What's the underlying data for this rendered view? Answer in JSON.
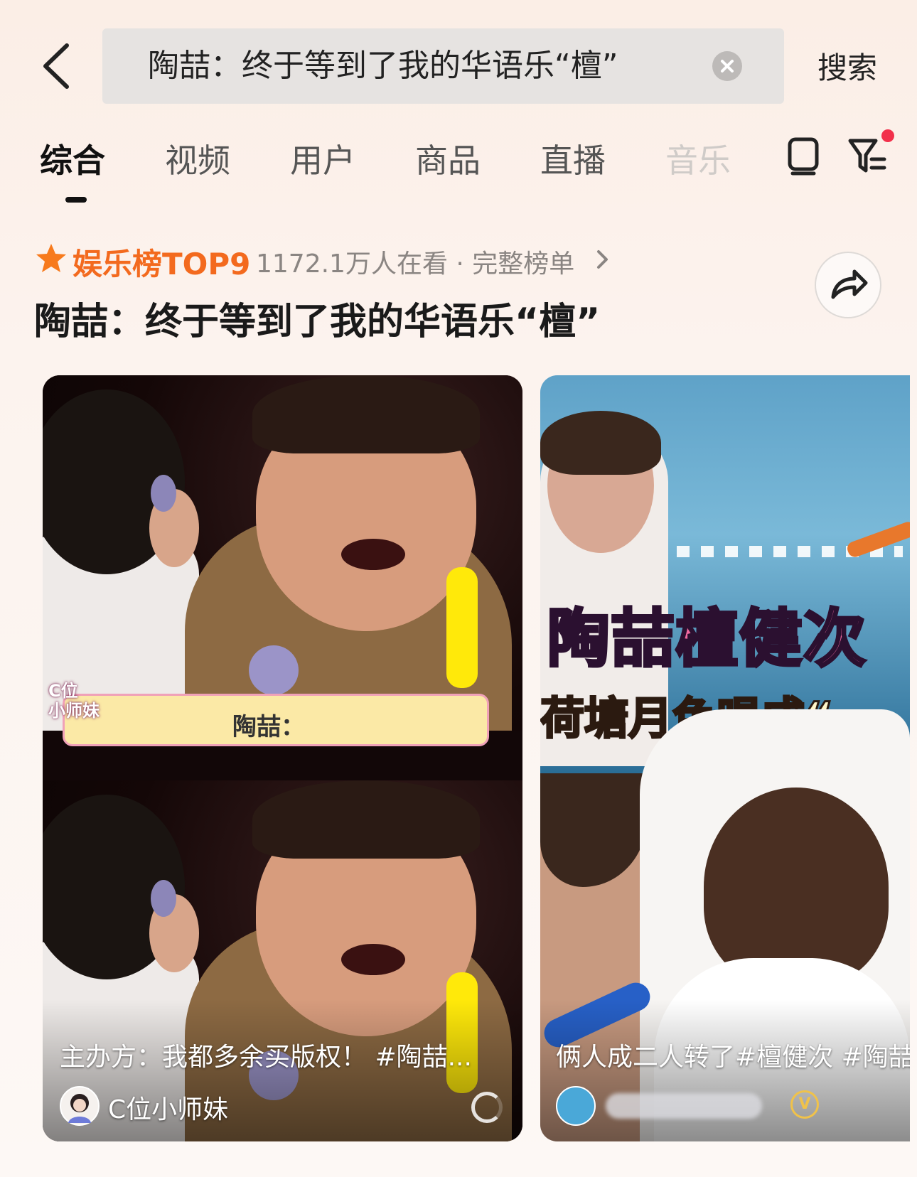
{
  "search": {
    "query": "陶喆：终于等到了我的华语乐“檀”",
    "submit_label": "搜索"
  },
  "tabs": [
    {
      "label": "综合",
      "active": true
    },
    {
      "label": "视频",
      "active": false
    },
    {
      "label": "用户",
      "active": false
    },
    {
      "label": "商品",
      "active": false
    },
    {
      "label": "直播",
      "active": false
    },
    {
      "label": "音乐",
      "active": false
    }
  ],
  "ranking": {
    "label": "娱乐榜TOP9",
    "meta": "1172.1万人在看 · 完整榜单",
    "accent_color": "#f36a1e"
  },
  "topic": {
    "title": "陶喆：终于等到了我的华语乐“檀”"
  },
  "cards": [
    {
      "badge": "C位\n小师妹",
      "caption": "陶喆：",
      "description": "主办方：我都多余买版权！ #陶喆...",
      "author": "C位小师妹"
    },
    {
      "overlay_title": "陶喆檀健次",
      "overlay_subtitle": "荷塘月色唱成“",
      "description": "俩人成二人转了#檀健次 #陶喆",
      "verified_badge": "V"
    }
  ],
  "icons": {
    "back": "chevron-left-icon",
    "clear": "clear-circle-icon",
    "filter": "filter-icon",
    "tab_extra": "device-icon",
    "share": "share-icon",
    "star": "star-icon"
  }
}
